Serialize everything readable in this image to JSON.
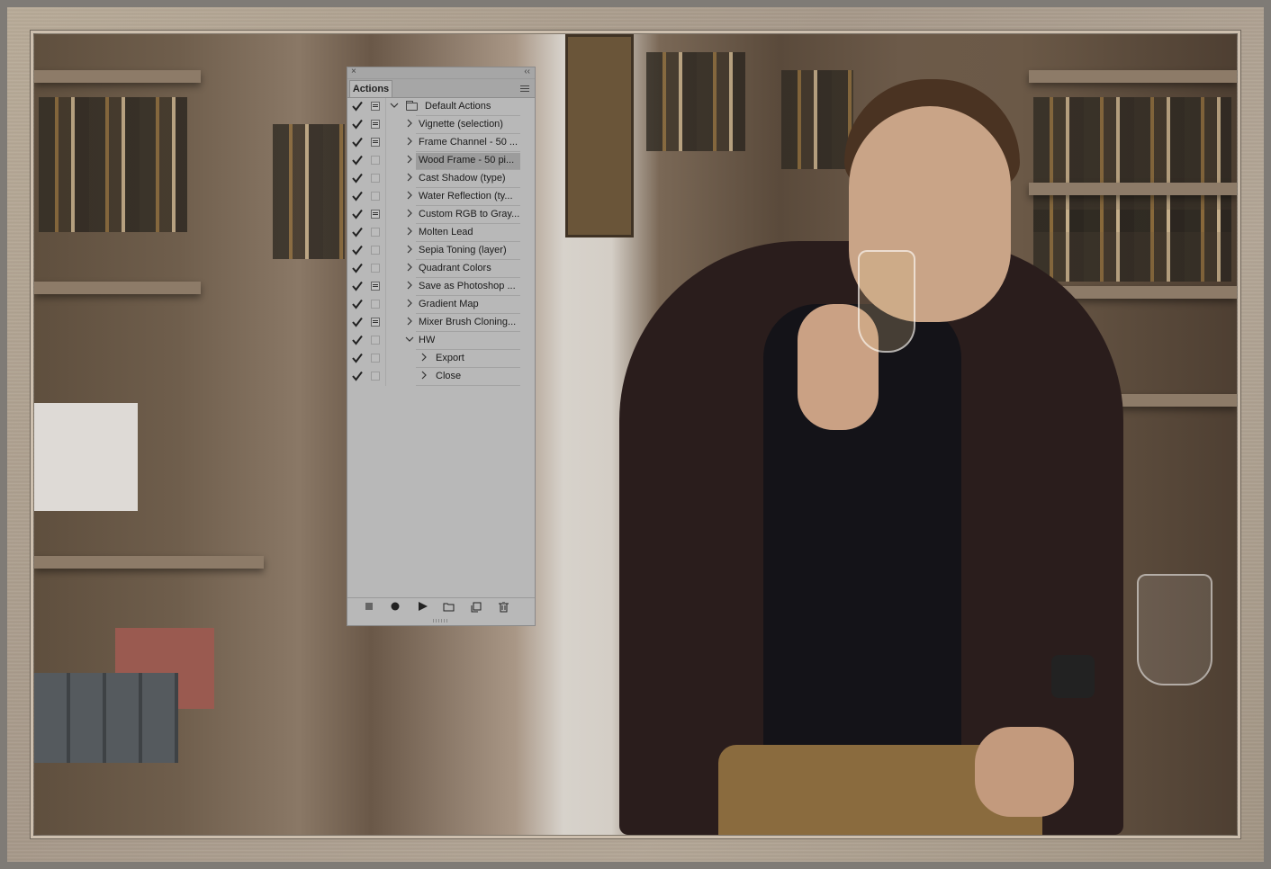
{
  "panel": {
    "tab_label": "Actions",
    "close_glyph": "×",
    "collapse_glyph": "‹‹"
  },
  "actions": [
    {
      "label": "Default Actions",
      "checked": true,
      "dialog": "on",
      "level": 0,
      "expanded": true,
      "folder": true,
      "selected": false
    },
    {
      "label": "Vignette (selection)",
      "checked": true,
      "dialog": "on",
      "level": 1,
      "expanded": false,
      "folder": false,
      "selected": false
    },
    {
      "label": "Frame Channel - 50 ...",
      "checked": true,
      "dialog": "on",
      "level": 1,
      "expanded": false,
      "folder": false,
      "selected": false
    },
    {
      "label": "Wood Frame - 50 pi...",
      "checked": true,
      "dialog": "off",
      "level": 1,
      "expanded": false,
      "folder": false,
      "selected": true
    },
    {
      "label": "Cast Shadow (type)",
      "checked": true,
      "dialog": "off",
      "level": 1,
      "expanded": false,
      "folder": false,
      "selected": false
    },
    {
      "label": "Water Reflection (ty...",
      "checked": true,
      "dialog": "off",
      "level": 1,
      "expanded": false,
      "folder": false,
      "selected": false
    },
    {
      "label": "Custom RGB to Gray...",
      "checked": true,
      "dialog": "on",
      "level": 1,
      "expanded": false,
      "folder": false,
      "selected": false
    },
    {
      "label": "Molten Lead",
      "checked": true,
      "dialog": "off",
      "level": 1,
      "expanded": false,
      "folder": false,
      "selected": false
    },
    {
      "label": "Sepia Toning (layer)",
      "checked": true,
      "dialog": "off",
      "level": 1,
      "expanded": false,
      "folder": false,
      "selected": false
    },
    {
      "label": "Quadrant Colors",
      "checked": true,
      "dialog": "off",
      "level": 1,
      "expanded": false,
      "folder": false,
      "selected": false
    },
    {
      "label": "Save as Photoshop ...",
      "checked": true,
      "dialog": "on",
      "level": 1,
      "expanded": false,
      "folder": false,
      "selected": false
    },
    {
      "label": "Gradient Map",
      "checked": true,
      "dialog": "off",
      "level": 1,
      "expanded": false,
      "folder": false,
      "selected": false
    },
    {
      "label": "Mixer Brush Cloning...",
      "checked": true,
      "dialog": "on",
      "level": 1,
      "expanded": false,
      "folder": false,
      "selected": false
    },
    {
      "label": "HW",
      "checked": true,
      "dialog": "off",
      "level": 1,
      "expanded": true,
      "folder": false,
      "selected": false
    },
    {
      "label": "Export",
      "checked": true,
      "dialog": "off",
      "level": 2,
      "expanded": false,
      "folder": false,
      "selected": false
    },
    {
      "label": "Close",
      "checked": true,
      "dialog": "off",
      "level": 2,
      "expanded": false,
      "folder": false,
      "selected": false
    }
  ],
  "footer": {
    "stop_icon": "stop-icon",
    "record_icon": "record-icon",
    "play_icon": "play-icon",
    "new_set_icon": "folder-icon",
    "new_action_icon": "new-item-icon",
    "delete_icon": "trash-icon"
  },
  "colors": {
    "panel_bg": "#b8b8b8",
    "selected_row": "#9c9c9c",
    "frame_wood": "#b1a492"
  }
}
